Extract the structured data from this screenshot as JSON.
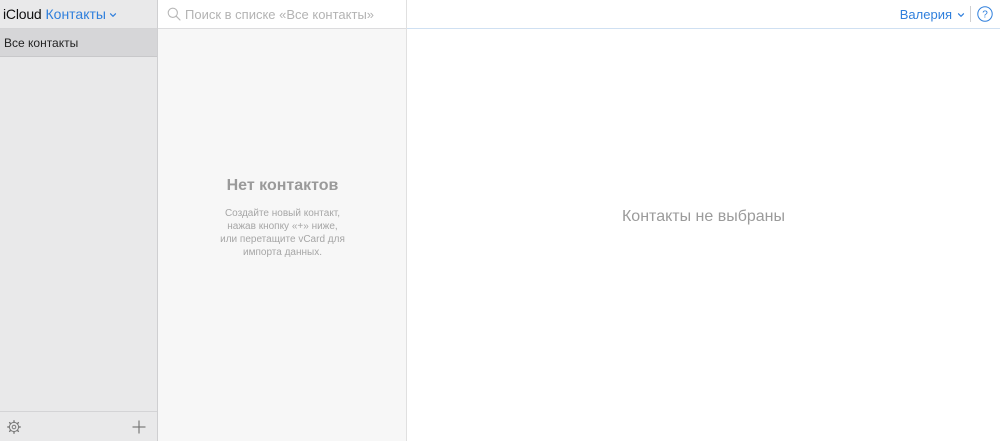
{
  "sidebar": {
    "brand": "iCloud",
    "app_name": "Контакты",
    "groups": [
      {
        "label": "Все контакты",
        "selected": true
      }
    ],
    "footer": {
      "settings_icon": "gear-icon",
      "add_icon": "plus-icon"
    }
  },
  "list": {
    "search": {
      "placeholder": "Поиск в списке «Все контакты»",
      "value": ""
    },
    "empty": {
      "title": "Нет контактов",
      "description_lines": [
        "Создайте новый контакт,",
        "нажав кнопку «+» ниже,",
        "или перетащите vCard для",
        "импорта данных."
      ]
    }
  },
  "topbar": {
    "user_name": "Валерия",
    "help_icon": "help-icon"
  },
  "detail": {
    "empty_text": "Контакты не выбраны"
  },
  "colors": {
    "accent": "#2f7fdc",
    "sidebar_bg": "#e9e9ea",
    "selected_bg": "#d6d6d8",
    "list_bg": "#f7f7f7",
    "muted_text": "#9b9b9b"
  }
}
